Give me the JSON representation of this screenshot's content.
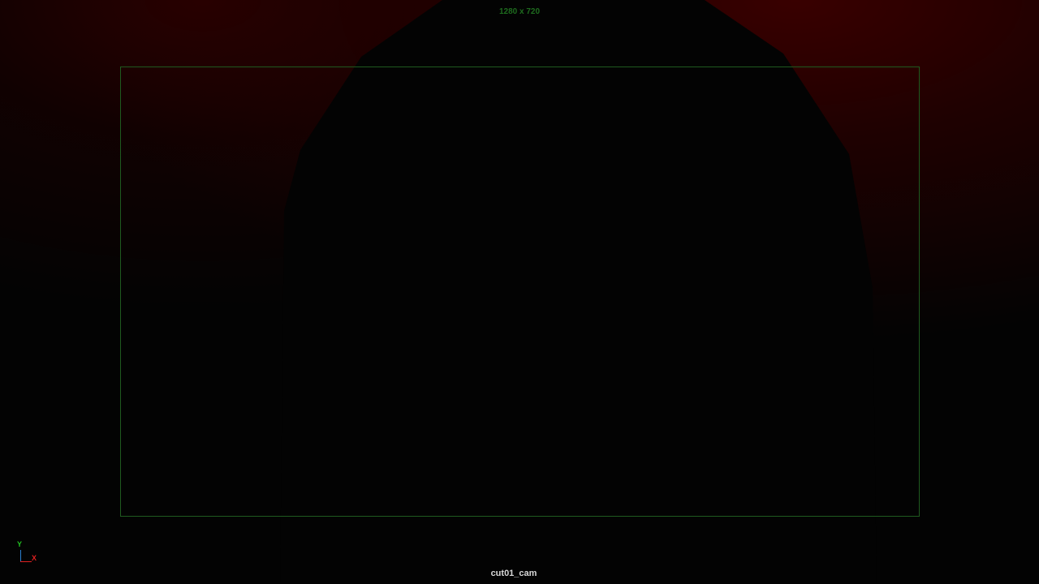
{
  "viewport": {
    "resolution_label": "1280 x 720",
    "camera_name": "cut01_cam"
  },
  "axis_gizmo": {
    "y_label": "Y",
    "x_label": "X",
    "y_color": "#22c322",
    "x_color": "#e02020"
  },
  "colors": {
    "background": "#030303",
    "backdrop_red": "#3c0000",
    "gate_green": "#1f5a1f",
    "label_green": "#1e6b1e"
  }
}
